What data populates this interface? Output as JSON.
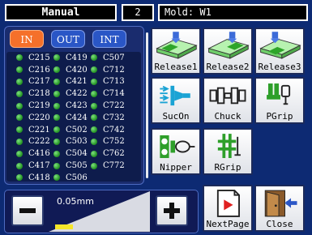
{
  "header": {
    "mode": "Manual",
    "number": "2",
    "mold": "Mold: W1"
  },
  "io_tabs": [
    {
      "label": "IN",
      "active": true
    },
    {
      "label": "OUT",
      "active": false
    },
    {
      "label": "INT",
      "active": false
    }
  ],
  "io_columns": [
    [
      "C215",
      "C216",
      "C217",
      "C218",
      "C219",
      "C220",
      "C221",
      "C222",
      "C416",
      "C417",
      "C418"
    ],
    [
      "C419",
      "C420",
      "C421",
      "C422",
      "C423",
      "C424",
      "C502",
      "C503",
      "C504",
      "C505",
      "C506"
    ],
    [
      "C507",
      "C712",
      "C713",
      "C714",
      "C722",
      "C732",
      "C742",
      "C752",
      "C762",
      "C772"
    ]
  ],
  "adjust": {
    "step_value": "0.05mm",
    "minus_icon": "minus-icon",
    "plus_icon": "plus-icon"
  },
  "actions": {
    "release1": "Release1",
    "release2": "Release2",
    "release3": "Release3",
    "sucon": "SucOn",
    "chuck": "Chuck",
    "pgrip": "PGrip",
    "nipper": "Nipper",
    "rgrip": "RGrip",
    "nextpage": "NextPage",
    "close": "Close"
  },
  "colors": {
    "background": "#0d2a73",
    "tab_active": "#f5702a",
    "tab_inactive": "#2a56c6",
    "led_on": "#2b9b2b"
  }
}
